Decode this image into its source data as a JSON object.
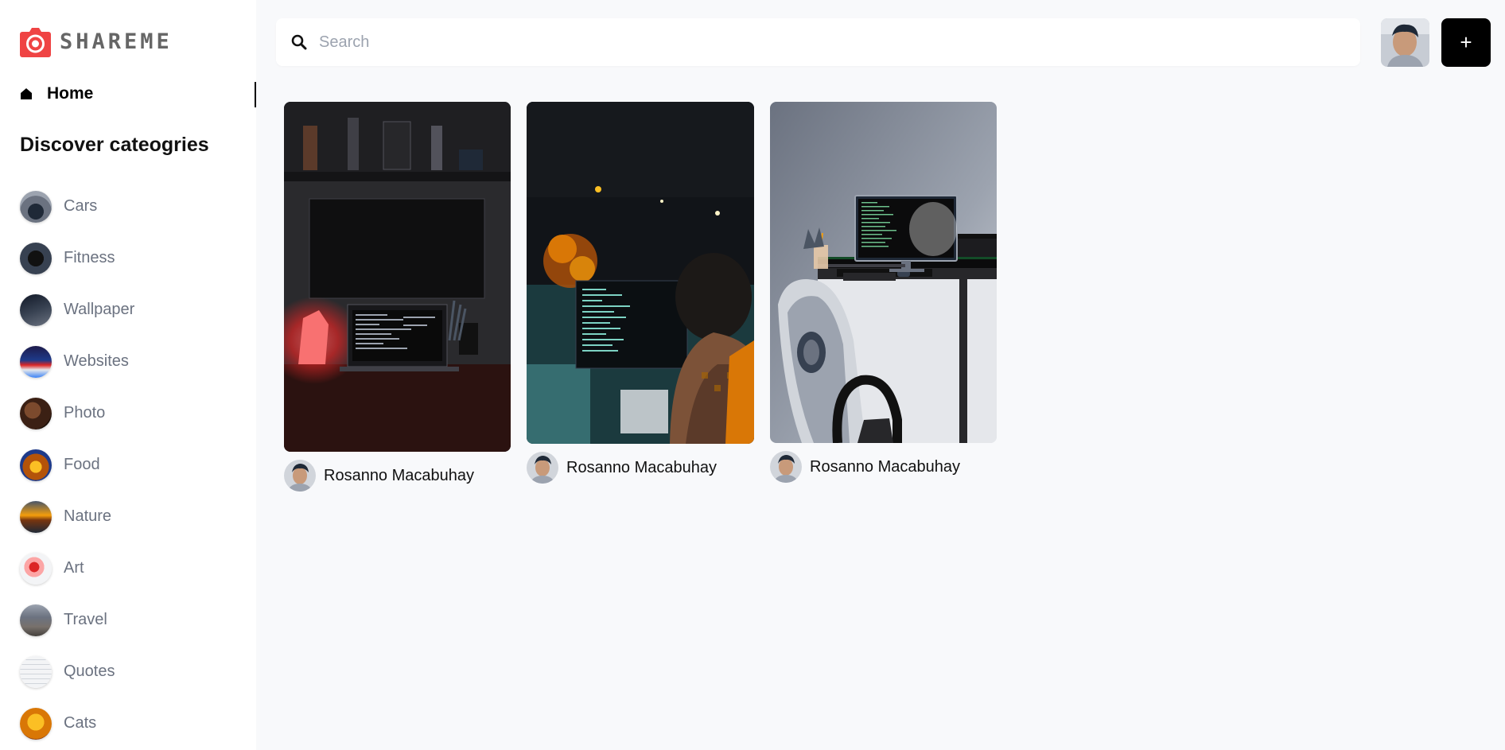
{
  "brand": {
    "name": "SHAREME",
    "logo_color": "#ef4444"
  },
  "sidebar": {
    "home_label": "Home",
    "section_title": "Discover cateogries",
    "categories": [
      {
        "label": "Cars",
        "thumb_color": "#4b5563"
      },
      {
        "label": "Fitness",
        "thumb_color": "#1f2937"
      },
      {
        "label": "Wallpaper",
        "thumb_color": "#374151"
      },
      {
        "label": "Websites",
        "thumb_color": "#1e3a8a"
      },
      {
        "label": "Photo",
        "thumb_color": "#5b3a29"
      },
      {
        "label": "Food",
        "thumb_color": "#a16207"
      },
      {
        "label": "Nature",
        "thumb_color": "#b45309"
      },
      {
        "label": "Art",
        "thumb_color": "#dc2626"
      },
      {
        "label": "Travel",
        "thumb_color": "#6b7280"
      },
      {
        "label": "Quotes",
        "thumb_color": "#e5e7eb"
      },
      {
        "label": "Cats",
        "thumb_color": "#d97706"
      }
    ]
  },
  "search": {
    "placeholder": "Search",
    "value": ""
  },
  "header": {
    "add_label": "+"
  },
  "pins": [
    {
      "author": "Rosanno Macabuhay"
    },
    {
      "author": "Rosanno Macabuhay"
    },
    {
      "author": "Rosanno Macabuhay"
    }
  ]
}
